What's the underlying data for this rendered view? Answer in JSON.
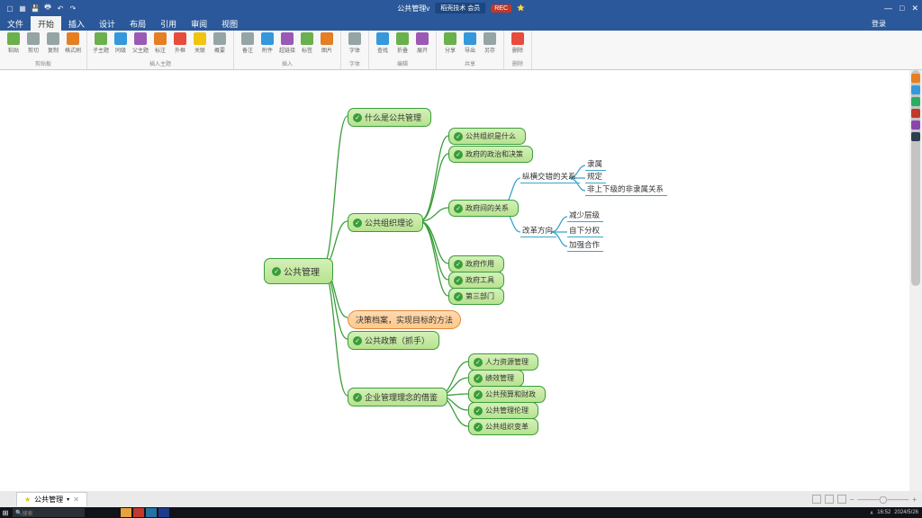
{
  "app": {
    "filename": "公共管理v",
    "login": "登录",
    "center_tag1": "稻壳技术 会员",
    "center_tag2": "REC"
  },
  "menu": [
    "文件",
    "开始",
    "插入",
    "设计",
    "布局",
    "引用",
    "审阅",
    "视图"
  ],
  "active_menu": 1,
  "ribbon_groups": [
    {
      "name": "剪贴板",
      "items": [
        {
          "l": "粘贴",
          "c": ""
        },
        {
          "l": "剪切",
          "c": "f"
        },
        {
          "l": "复制",
          "c": "f"
        },
        {
          "l": "格式刷",
          "c": "b"
        }
      ]
    },
    {
      "name": "插入主题",
      "items": [
        {
          "l": "子主题",
          "c": ""
        },
        {
          "l": "同级",
          "c": "c"
        },
        {
          "l": "父主题",
          "c": "d"
        },
        {
          "l": "标注",
          "c": "b"
        },
        {
          "l": "外框",
          "c": "e"
        },
        {
          "l": "关联",
          "c": "g"
        },
        {
          "l": "概要",
          "c": "f"
        }
      ]
    },
    {
      "name": "插入",
      "items": [
        {
          "l": "备注",
          "c": "f"
        },
        {
          "l": "附件",
          "c": "c"
        },
        {
          "l": "超链接",
          "c": "d"
        },
        {
          "l": "标签",
          "c": ""
        },
        {
          "l": "图片",
          "c": "b"
        }
      ]
    },
    {
      "name": "字体",
      "items": [
        {
          "l": "字体",
          "c": "f"
        }
      ]
    },
    {
      "name": "编辑",
      "items": [
        {
          "l": "查找",
          "c": "c"
        },
        {
          "l": "折叠",
          "c": ""
        },
        {
          "l": "展开",
          "c": "d"
        }
      ]
    },
    {
      "name": "共享",
      "items": [
        {
          "l": "分享",
          "c": ""
        },
        {
          "l": "导出",
          "c": "c"
        },
        {
          "l": "另存",
          "c": "f"
        }
      ]
    },
    {
      "name": "删除",
      "items": [
        {
          "l": "删除",
          "c": "e"
        }
      ]
    }
  ],
  "tab": {
    "label": "公共管理"
  },
  "search_placeholder": "搜索",
  "clock": "16:52",
  "date": "2024/5/26",
  "chart_data": {
    "type": "mindmap",
    "root": {
      "text": "公共管理",
      "children": [
        {
          "text": "什么是公共管理"
        },
        {
          "text": "公共组织理论",
          "children": [
            {
              "text": "公共组织是什么"
            },
            {
              "text": "政府的政治和决策"
            },
            {
              "text": "政府间的关系",
              "children": [
                {
                  "text": "纵横交错的关系",
                  "children": [
                    {
                      "text": "隶属"
                    },
                    {
                      "text": "规定"
                    },
                    {
                      "text": "非上下级的非隶属关系"
                    }
                  ]
                },
                {
                  "text": "改革方向",
                  "children": [
                    {
                      "text": "减少层级"
                    },
                    {
                      "text": "自下分权"
                    },
                    {
                      "text": "加强合作"
                    }
                  ]
                }
              ]
            },
            {
              "text": "政府作用"
            },
            {
              "text": "政府工具"
            },
            {
              "text": "第三部门"
            }
          ]
        },
        {
          "text": "决策档案，实现目标的方法",
          "kind": "note"
        },
        {
          "text": "公共政策（抓手）"
        },
        {
          "text": "企业管理理念的借鉴",
          "children": [
            {
              "text": "人力资源管理"
            },
            {
              "text": "绩效管理"
            },
            {
              "text": "公共预算和财政"
            },
            {
              "text": "公共管理伦理"
            },
            {
              "text": "公共组织变革"
            }
          ]
        }
      ]
    }
  },
  "nodes": {
    "root": "公共管理",
    "n1": "什么是公共管理",
    "n2": "公共组织理论",
    "n2a": "公共组织是什么",
    "n2b": "政府的政治和决策",
    "n2c": "政府间的关系",
    "n2c1": "纵横交错的关系",
    "n2c1a": "隶属",
    "n2c1b": "规定",
    "n2c1c": "非上下级的非隶属关系",
    "n2c2": "改革方向",
    "n2c2a": "减少层级",
    "n2c2b": "自下分权",
    "n2c2c": "加强合作",
    "n2d": "政府作用",
    "n2e": "政府工具",
    "n2f": "第三部门",
    "n3": "决策档案，实现目标的方法",
    "n4": "公共政策（抓手）",
    "n5": "企业管理理念的借鉴",
    "n5a": "人力资源管理",
    "n5b": "绩效管理",
    "n5c": "公共预算和财政",
    "n5d": "公共管理伦理",
    "n5e": "公共组织变革"
  }
}
